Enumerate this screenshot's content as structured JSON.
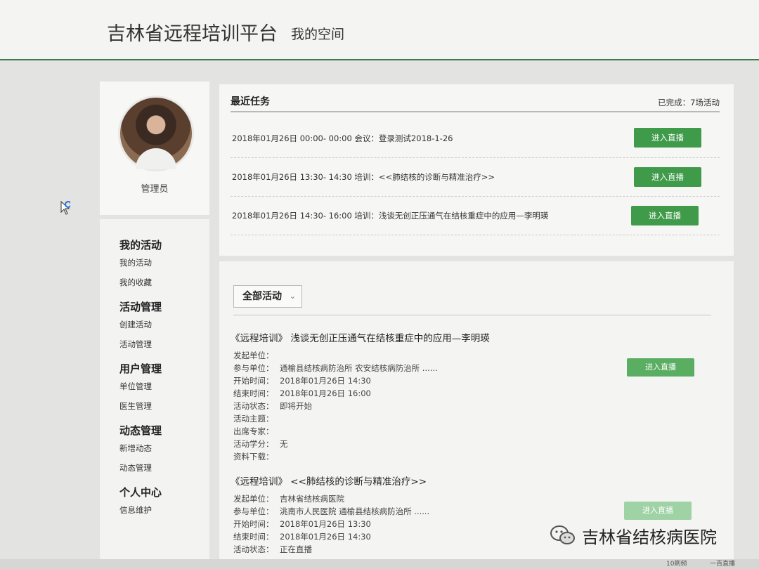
{
  "header": {
    "title": "吉林省远程培训平台",
    "subtitle": "我的空间"
  },
  "profile": {
    "role": "管理员"
  },
  "menu": {
    "groups": [
      {
        "title": "我的活动",
        "items": [
          "我的活动",
          "我的收藏"
        ]
      },
      {
        "title": "活动管理",
        "items": [
          "创建活动",
          "活动管理"
        ]
      },
      {
        "title": "用户管理",
        "items": [
          "单位管理",
          "医生管理"
        ]
      },
      {
        "title": "动态管理",
        "items": [
          "新增动态",
          "动态管理"
        ]
      },
      {
        "title": "个人中心",
        "items": [
          "信息维护"
        ]
      }
    ]
  },
  "tasks": {
    "title": "最近任务",
    "completed": "已完成：7场活动",
    "button_label": "进入直播",
    "rows": [
      "2018年01月26日 00:00- 00:00  会议：登录测试2018-1-26",
      "2018年01月26日 13:30- 14:30  培训：<<肺结核的诊断与精准治疗>>",
      "2018年01月26日 14:30- 16:00  培训：浅谈无创正压通气在结核重症中的应用—李明瑛"
    ]
  },
  "activities": {
    "filter": "全部活动",
    "button_label": "进入直播",
    "items": [
      {
        "title": "《远程培训》 浅谈无创正压通气在结核重症中的应用—李明瑛",
        "fields": [
          {
            "k": "发起单位：",
            "v": ""
          },
          {
            "k": "参与单位：",
            "v": "通榆县结核病防治所 农安结核病防治所 ......"
          },
          {
            "k": "开始时间：",
            "v": "2018年01月26日 14:30"
          },
          {
            "k": "结束时间：",
            "v": "2018年01月26日 16:00"
          },
          {
            "k": "活动状态：",
            "v": "即将开始"
          },
          {
            "k": "活动主题：",
            "v": ""
          },
          {
            "k": "出席专家：",
            "v": ""
          },
          {
            "k": "活动学分：",
            "v": "无"
          },
          {
            "k": "资料下载：",
            "v": ""
          }
        ]
      },
      {
        "title": "《远程培训》 <<肺结核的诊断与精准治疗>>",
        "fields": [
          {
            "k": "发起单位：",
            "v": "吉林省结核病医院"
          },
          {
            "k": "参与单位：",
            "v": "洮南市人民医院 通榆县结核病防治所 ......"
          },
          {
            "k": "开始时间：",
            "v": "2018年01月26日 13:30"
          },
          {
            "k": "结束时间：",
            "v": "2018年01月26日 14:30"
          },
          {
            "k": "活动状态：",
            "v": "正在直播"
          }
        ]
      }
    ]
  },
  "watermark": {
    "text": "吉林省结核病医院",
    "icon": "wechat-icon"
  },
  "taskbar": {
    "items": [
      "10刷频",
      "一百直播"
    ]
  }
}
